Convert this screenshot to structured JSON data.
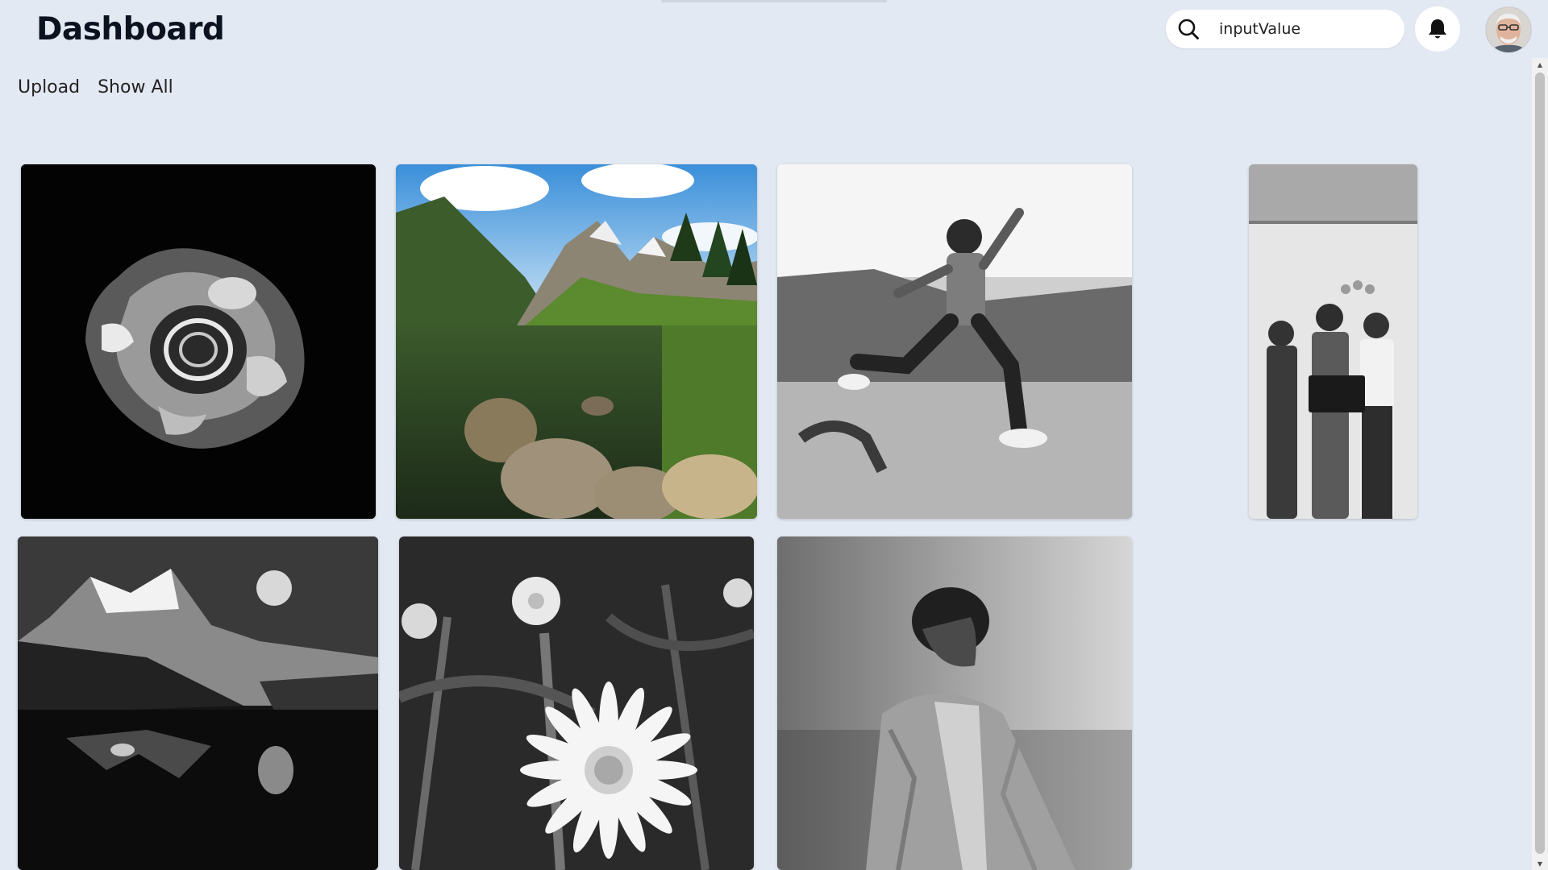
{
  "header": {
    "title": "Dashboard",
    "search": {
      "value": "inputValue",
      "placeholder": ""
    },
    "notifications_icon": "bell-icon",
    "profile_icon": "avatar"
  },
  "nav": {
    "items": [
      {
        "label": "Upload"
      },
      {
        "label": "Show All"
      }
    ]
  },
  "gallery": {
    "items": [
      {
        "subject": "abstract-black-white-sculpture"
      },
      {
        "subject": "mountain-lake-landscape"
      },
      {
        "subject": "jumping-man-beach"
      },
      {
        "subject": "family-holding-laptop"
      },
      {
        "subject": "moonlit-mountain-lake"
      },
      {
        "subject": "daisy-flower"
      },
      {
        "subject": "man-in-denim-jacket"
      }
    ]
  },
  "colors": {
    "background": "#e3e9f2",
    "title": "#0b1220",
    "surface": "#ffffff"
  }
}
